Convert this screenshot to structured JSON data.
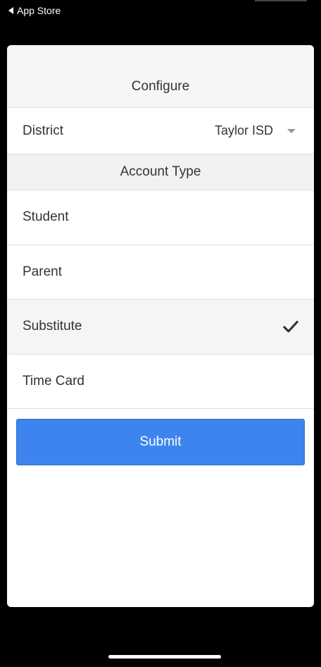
{
  "status_bar": {
    "back_label": "App Store"
  },
  "sheet": {
    "title": "Configure"
  },
  "district": {
    "label": "District",
    "selected_value": "Taylor ISD"
  },
  "account_type": {
    "title": "Account Type",
    "options": [
      {
        "label": "Student",
        "selected": false
      },
      {
        "label": "Parent",
        "selected": false
      },
      {
        "label": "Substitute",
        "selected": true
      },
      {
        "label": "Time Card",
        "selected": false
      }
    ]
  },
  "submit": {
    "label": "Submit"
  },
  "colors": {
    "primary": "#3e84ef",
    "background": "#000000",
    "sheet": "#ffffff",
    "selected_row": "#f5f5f5"
  },
  "icons": {
    "back": "back-arrow-icon",
    "dropdown": "caret-down-icon",
    "selected": "checkmark-icon"
  }
}
